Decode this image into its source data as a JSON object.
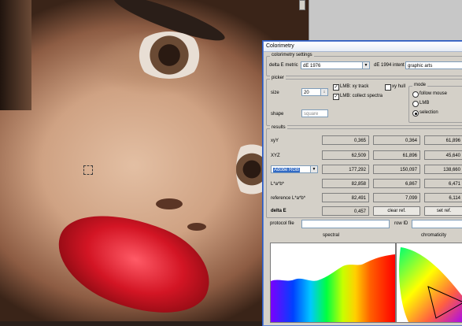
{
  "dialog": {
    "title": "Colorimetry",
    "settings": {
      "group_label": "colorimetry settings",
      "delta_metric_label": "delta E metric",
      "delta_metric_value": "dE 1976",
      "intent_label": "dE 1994 intent",
      "intent_value": "graphic arts"
    },
    "picker": {
      "group_label": "picker",
      "size_label": "size",
      "size_value": "20",
      "shape_label": "shape",
      "shape_value": "square",
      "lmb_xy_track": "LMB: xy track",
      "lmb_collect": "LMB: collect spectra",
      "xy_hull": "xy hull",
      "mode_label": "mode",
      "mode_follow": "follow mouse",
      "mode_lmb": "LMB",
      "mode_selection": "selection"
    },
    "results": {
      "group_label": "results",
      "rows": [
        {
          "label": "xyY",
          "v1": "0,365",
          "v2": "0,364",
          "v3": "61,896"
        },
        {
          "label": "XYZ",
          "v1": "62,509",
          "v2": "61,896",
          "v3": "45,640"
        },
        {
          "label": "Adobe RGB",
          "v1": "177,292",
          "v2": "150,097",
          "v3": "138,660"
        },
        {
          "label": "L*a*b*",
          "v1": "82,858",
          "v2": "6,867",
          "v3": "6,471"
        },
        {
          "label": "reference L*a*b*",
          "v1": "82,491",
          "v2": "7,099",
          "v3": "6,114"
        }
      ],
      "delta_label": "delta E",
      "delta_value": "0,457",
      "clear_ref": "clear ref.",
      "set_ref": "set ref."
    },
    "protocol_label": "protocol file",
    "row_id_label": "row ID",
    "spectral_label": "spectral",
    "chromaticity_label": "chromaticity"
  },
  "colors": {
    "dialog_bg": "#d4d0c8",
    "accent": "#316ac5",
    "lip_red": "#d31524"
  }
}
